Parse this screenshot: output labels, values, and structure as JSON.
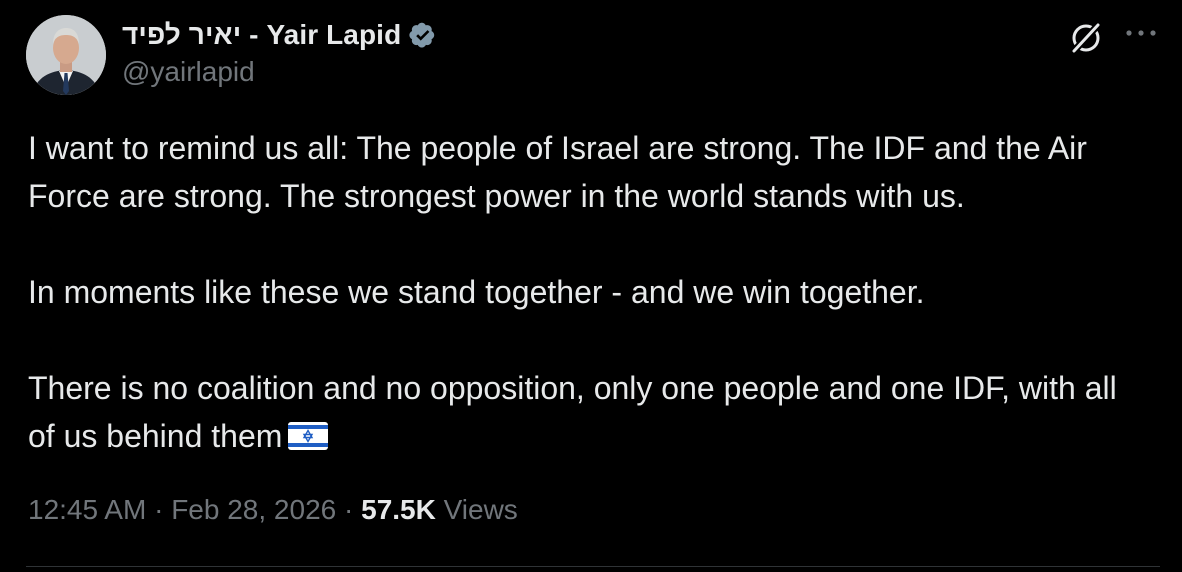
{
  "author": {
    "display_name": "יאיר לפיד - Yair Lapid",
    "handle": "@yairlapid",
    "verified": true,
    "avatar": "avatar-photo"
  },
  "header_actions": {
    "grok_icon": "grok-icon",
    "more_icon": "more-icon"
  },
  "tweet": {
    "paragraphs": [
      "I want to remind us all: The people of Israel are strong. The IDF and the Air Force are strong. The strongest power in the world stands with us.",
      "In moments like these we stand together - and we win together.",
      "There is no coalition and no opposition, only one people and one IDF, with all of us behind them"
    ],
    "emoji": "israel-flag"
  },
  "meta": {
    "time": "12:45 AM",
    "separator": "·",
    "date": "Feb 28, 2026",
    "views_count": "57.5K",
    "views_label": "Views"
  },
  "colors": {
    "background": "#000000",
    "text": "#e7e9ea",
    "secondary": "#71767b",
    "verified_blue": "#829aab",
    "divider": "#2f3336"
  }
}
